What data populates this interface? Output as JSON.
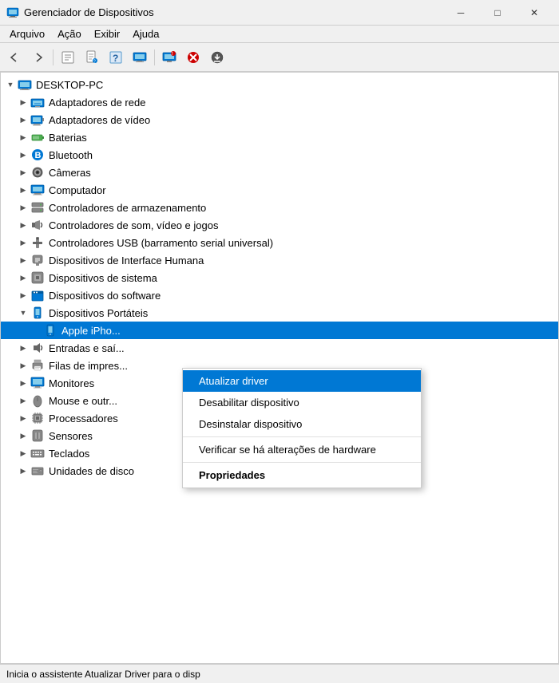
{
  "window": {
    "title": "Gerenciador de Dispositivos",
    "icon": "💻",
    "min_btn": "─",
    "max_btn": "□",
    "close_btn": "✕"
  },
  "menubar": {
    "items": [
      "Arquivo",
      "Ação",
      "Exibir",
      "Ajuda"
    ]
  },
  "toolbar": {
    "buttons": [
      {
        "name": "back",
        "icon": "←"
      },
      {
        "name": "forward",
        "icon": "→"
      },
      {
        "name": "show-properties",
        "icon": "🗒"
      },
      {
        "name": "update-driver",
        "icon": "📄"
      },
      {
        "name": "help",
        "icon": "❓"
      },
      {
        "name": "view-devices",
        "icon": "📋"
      },
      {
        "name": "scan",
        "icon": "🖥"
      },
      {
        "name": "uninstall",
        "icon": "❌"
      },
      {
        "name": "download",
        "icon": "⬇"
      }
    ]
  },
  "tree": {
    "root": {
      "label": "DESKTOP-PC",
      "expanded": true
    },
    "items": [
      {
        "id": "net",
        "label": "Adaptadores de rede",
        "indent": 1,
        "icon": "network",
        "expanded": false
      },
      {
        "id": "video",
        "label": "Adaptadores de vídeo",
        "indent": 1,
        "icon": "monitor",
        "expanded": false
      },
      {
        "id": "bat",
        "label": "Baterias",
        "indent": 1,
        "icon": "battery",
        "expanded": false
      },
      {
        "id": "bt",
        "label": "Bluetooth",
        "indent": 1,
        "icon": "bluetooth",
        "expanded": false
      },
      {
        "id": "cam",
        "label": "Câmeras",
        "indent": 1,
        "icon": "camera",
        "expanded": false
      },
      {
        "id": "comp",
        "label": "Computador",
        "indent": 1,
        "icon": "computer",
        "expanded": false
      },
      {
        "id": "storage",
        "label": "Controladores de armazenamento",
        "indent": 1,
        "icon": "storage",
        "expanded": false
      },
      {
        "id": "sound",
        "label": "Controladores de som, vídeo e jogos",
        "indent": 1,
        "icon": "sound",
        "expanded": false
      },
      {
        "id": "usb",
        "label": "Controladores USB (barramento serial universal)",
        "indent": 1,
        "icon": "usb",
        "expanded": false
      },
      {
        "id": "hid",
        "label": "Dispositivos de Interface Humana",
        "indent": 1,
        "icon": "hid",
        "expanded": false
      },
      {
        "id": "sys",
        "label": "Dispositivos de sistema",
        "indent": 1,
        "icon": "system",
        "expanded": false
      },
      {
        "id": "soft",
        "label": "Dispositivos do software",
        "indent": 1,
        "icon": "software",
        "expanded": false
      },
      {
        "id": "portable",
        "label": "Dispositivos Portáteis",
        "indent": 1,
        "icon": "portable",
        "expanded": true
      },
      {
        "id": "iphone",
        "label": "Apple iPho...",
        "indent": 2,
        "icon": "portable-device",
        "expanded": false,
        "selected": true
      },
      {
        "id": "audio",
        "label": "Entradas e saí...",
        "indent": 1,
        "icon": "audio",
        "expanded": false
      },
      {
        "id": "print",
        "label": "Filas de impres...",
        "indent": 1,
        "icon": "printer",
        "expanded": false
      },
      {
        "id": "monitors",
        "label": "Monitores",
        "indent": 1,
        "icon": "monitor2",
        "expanded": false
      },
      {
        "id": "mouse",
        "label": "Mouse e outr...",
        "indent": 1,
        "icon": "mouse",
        "expanded": false
      },
      {
        "id": "proc",
        "label": "Processadores",
        "indent": 1,
        "icon": "processor",
        "expanded": false
      },
      {
        "id": "sensors",
        "label": "Sensores",
        "indent": 1,
        "icon": "sensor",
        "expanded": false
      },
      {
        "id": "keyboard",
        "label": "Teclados",
        "indent": 1,
        "icon": "keyboard",
        "expanded": false
      },
      {
        "id": "disk",
        "label": "Unidades de disco",
        "indent": 1,
        "icon": "disk",
        "expanded": false
      }
    ]
  },
  "context_menu": {
    "items": [
      {
        "id": "update",
        "label": "Atualizar driver",
        "highlighted": true,
        "bold": false
      },
      {
        "id": "disable",
        "label": "Desabilitar dispositivo",
        "highlighted": false,
        "bold": false
      },
      {
        "id": "uninstall",
        "label": "Desinstalar dispositivo",
        "highlighted": false,
        "bold": false
      },
      {
        "id": "scan",
        "label": "Verificar se há alterações de hardware",
        "highlighted": false,
        "bold": false
      },
      {
        "id": "props",
        "label": "Propriedades",
        "highlighted": false,
        "bold": true
      }
    ]
  },
  "status_bar": {
    "text": "Inicia o assistente Atualizar Driver para o disp"
  }
}
